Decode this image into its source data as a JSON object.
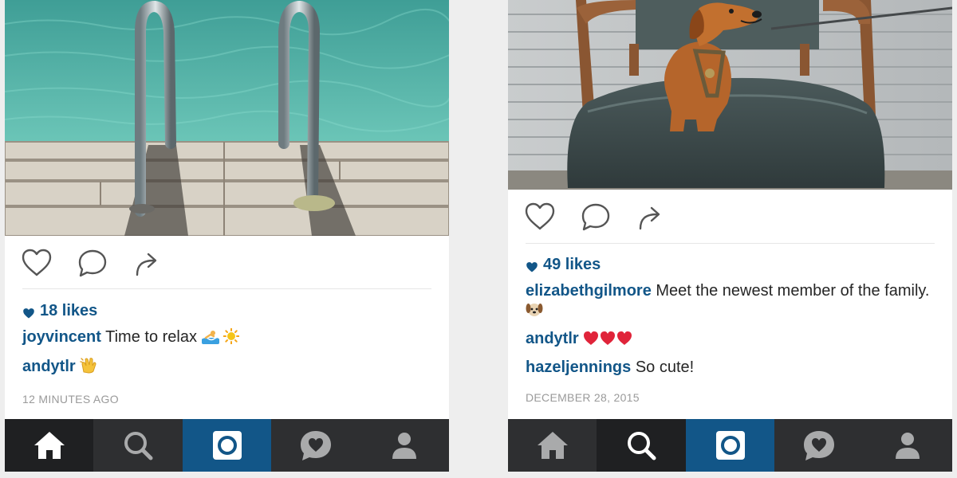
{
  "posts": [
    {
      "likes": "18 likes",
      "caption_user": "joyvincent",
      "caption_text": "Time to relax",
      "comments": [
        {
          "user": "andytlr",
          "text": ""
        }
      ],
      "timestamp": "12 MINUTES AGO",
      "emojis": [
        "swimmer-emoji",
        "sun-emoji",
        "clapping-hands-emoji"
      ],
      "active_tab": "home"
    },
    {
      "likes": "49 likes",
      "caption_user": "elizabethgilmore",
      "caption_text": "Meet the newest member of the family.",
      "comments": [
        {
          "user": "andytlr",
          "text": ""
        },
        {
          "user": "hazeljennings",
          "text": "So cute!"
        }
      ],
      "timestamp": "DECEMBER 28, 2015",
      "emojis": [
        "dog-face-emoji",
        "red-hearts-emoji"
      ],
      "active_tab": "search"
    }
  ],
  "tabbar": {
    "tabs": [
      "home",
      "search",
      "camera",
      "activity",
      "profile"
    ]
  },
  "colors": {
    "link": "#125688",
    "tab_background": "#2e2f31",
    "tab_active": "#1f2022",
    "camera_tab": "#125688"
  }
}
